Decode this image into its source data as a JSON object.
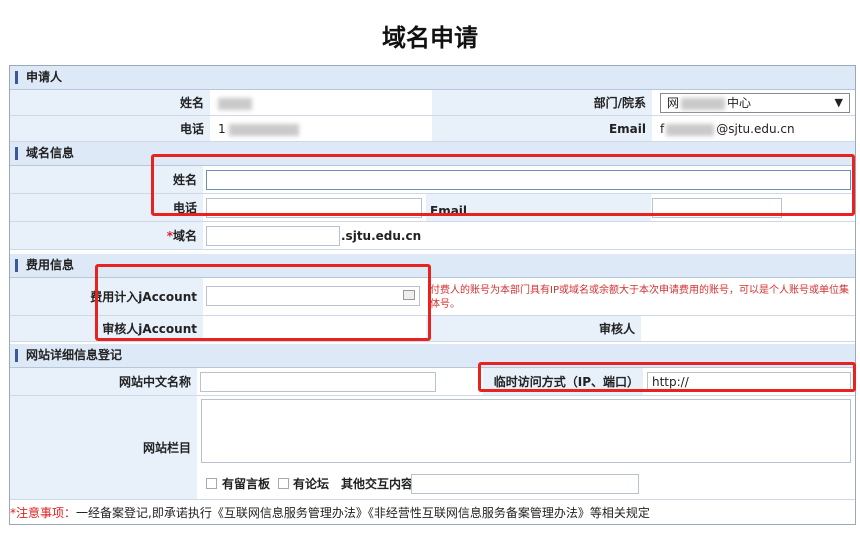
{
  "page_title": "域名申请",
  "applicant": {
    "section": "申请人",
    "name_label": "姓名",
    "name_value": "ż",
    "dept_label": "部门/院系",
    "dept_value": "网",
    "dept_value_suffix": "中心",
    "phone_label": "电话",
    "phone_value": "1",
    "email_label": "Email",
    "email_value_prefix": "f",
    "email_value_suffix": "@sjtu.edu.cn"
  },
  "domain": {
    "section": "域名信息",
    "name_label": "姓名",
    "phone_label": "电话",
    "email_label": "Email",
    "domain_required": "*",
    "domain_label": "域名",
    "domain_suffix": ".sjtu.edu.cn"
  },
  "fee": {
    "section": "费用信息",
    "account_label": "费用计入jAccount",
    "reviewer_account_label": "审核人jAccount",
    "reviewer_label": "审核人",
    "note": "付费人的账号为本部门具有IP或域名或余额大于本次申请费用的账号，可以是个人账号或单位集体号。"
  },
  "site": {
    "section": "网站详细信息登记",
    "cn_name_label": "网站中文名称",
    "temp_access_label": "临时访问方式（IP、端口）",
    "temp_access_value": "http://",
    "columns_label": "网站栏目",
    "guestbook_label": "有留言板",
    "forum_label": "有论坛",
    "other_label": "其他交互内容"
  },
  "footer": {
    "note_label": "*注意事项：",
    "note_text": "一经备案登记,即承诺执行《互联网信息服务管理办法》《非经营性互联网信息服务备案管理办法》等相关规定"
  }
}
